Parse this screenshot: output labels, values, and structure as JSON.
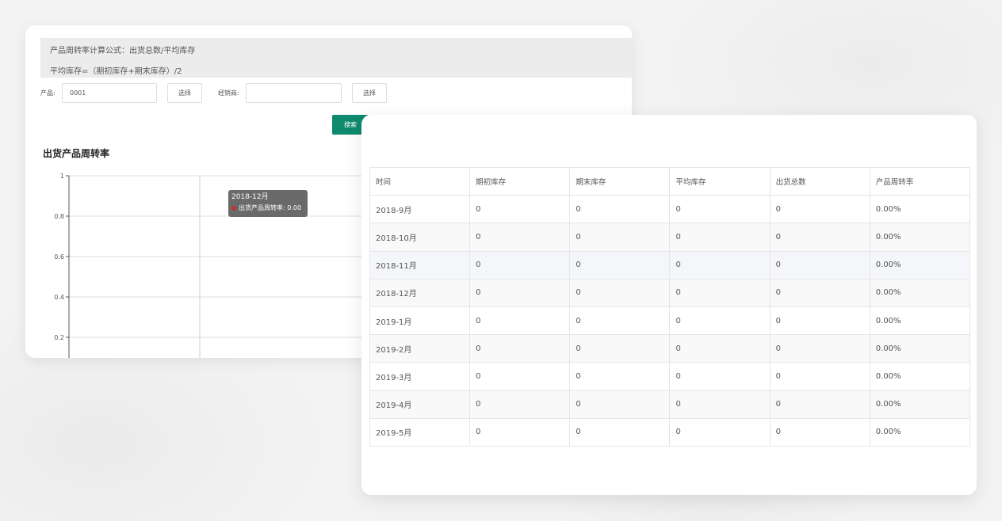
{
  "formula": {
    "line1": "产品周转率计算公式：出货总数/平均库存",
    "line2": "平均库存=（期初库存+期末库存）/2"
  },
  "filters": {
    "product_label": "产品:",
    "product_value": "0001",
    "product_select": "选择",
    "dealer_label": "经销商:",
    "dealer_value": "",
    "dealer_select": "选择",
    "search_label": "搜索"
  },
  "chart_title": "出货产品周转率",
  "chart_data": {
    "type": "line",
    "title": "出货产品周转率",
    "ylim": [
      0,
      1
    ],
    "yticks": [
      "1",
      "0.8",
      "0.6",
      "0.4",
      "0.2"
    ],
    "grid": true,
    "tooltip": {
      "category": "2018-12月",
      "series": "出货产品周转率",
      "value": "0.00"
    }
  },
  "table": {
    "headers": [
      "时间",
      "期初库存",
      "期末库存",
      "平均库存",
      "出货总数",
      "产品周转率"
    ],
    "rows": [
      [
        "2018-9月",
        "0",
        "0",
        "0",
        "0",
        "0.00%"
      ],
      [
        "2018-10月",
        "0",
        "0",
        "0",
        "0",
        "0.00%"
      ],
      [
        "2018-11月",
        "0",
        "0",
        "0",
        "0",
        "0.00%"
      ],
      [
        "2018-12月",
        "0",
        "0",
        "0",
        "0",
        "0.00%"
      ],
      [
        "2019-1月",
        "0",
        "0",
        "0",
        "0",
        "0.00%"
      ],
      [
        "2019-2月",
        "0",
        "0",
        "0",
        "0",
        "0.00%"
      ],
      [
        "2019-3月",
        "0",
        "0",
        "0",
        "0",
        "0.00%"
      ],
      [
        "2019-4月",
        "0",
        "0",
        "0",
        "0",
        "0.00%"
      ],
      [
        "2019-5月",
        "0",
        "0",
        "0",
        "0",
        "0.00%"
      ]
    ]
  },
  "colors": {
    "accent": "#0e8a6e",
    "series": "#c23531"
  }
}
